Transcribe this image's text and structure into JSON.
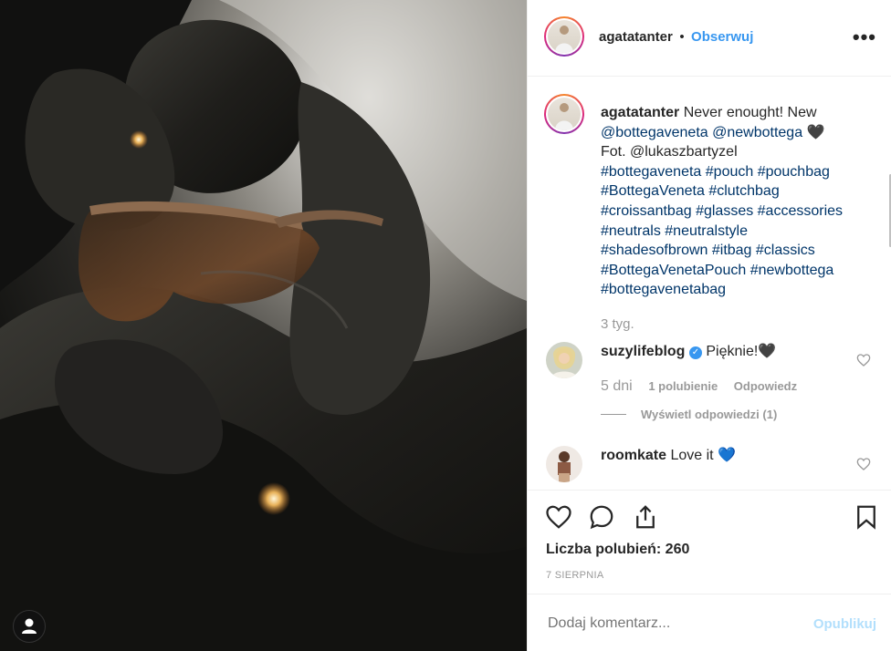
{
  "post": {
    "author": "agatatanter",
    "separator": "•",
    "follow_label": "Obserwuj",
    "more_label": "•••"
  },
  "caption": {
    "author": "agatatanter",
    "lines": [
      "Never enought! New",
      "@bottegaveneta @newbottega 🖤",
      "Fot. @lukaszbartyzel",
      "#bottegaveneta #pouch #pouchbag",
      "#BottegaVeneta #clutchbag",
      "#croissantbag #glasses #accessories",
      "#neutrals #neutralstyle",
      "#shadesofbrown #itbag #classics",
      "#BottegaVenetaPouch #newbottega",
      "#bottegavenetabag"
    ],
    "time": "3 tyg."
  },
  "comments": [
    {
      "user": "suzylifeblog",
      "text": "Pięknie!🖤",
      "age": "5 dni",
      "likes": "1 polubienie",
      "reply_label": "Odpowiedz",
      "view_replies": "Wyświetl odpowiedzi (1)"
    },
    {
      "user": "roomkate",
      "text": "Love it 💙"
    }
  ],
  "stats": {
    "likes_text": "Liczba polubień: 260",
    "date": "7 SIERPNIA"
  },
  "add_comment": {
    "placeholder": "Dodaj komentarz...",
    "publish_label": "Opublikuj"
  },
  "colors": {
    "accent": "#3897f0",
    "hashtag": "#003569",
    "muted": "#999999",
    "publish_disabled": "#b2dffc"
  },
  "icons": {
    "heart": "heart-icon",
    "comment": "comment-icon",
    "share": "share-icon",
    "bookmark": "bookmark-icon",
    "more": "more-icon",
    "user": "user-icon"
  }
}
